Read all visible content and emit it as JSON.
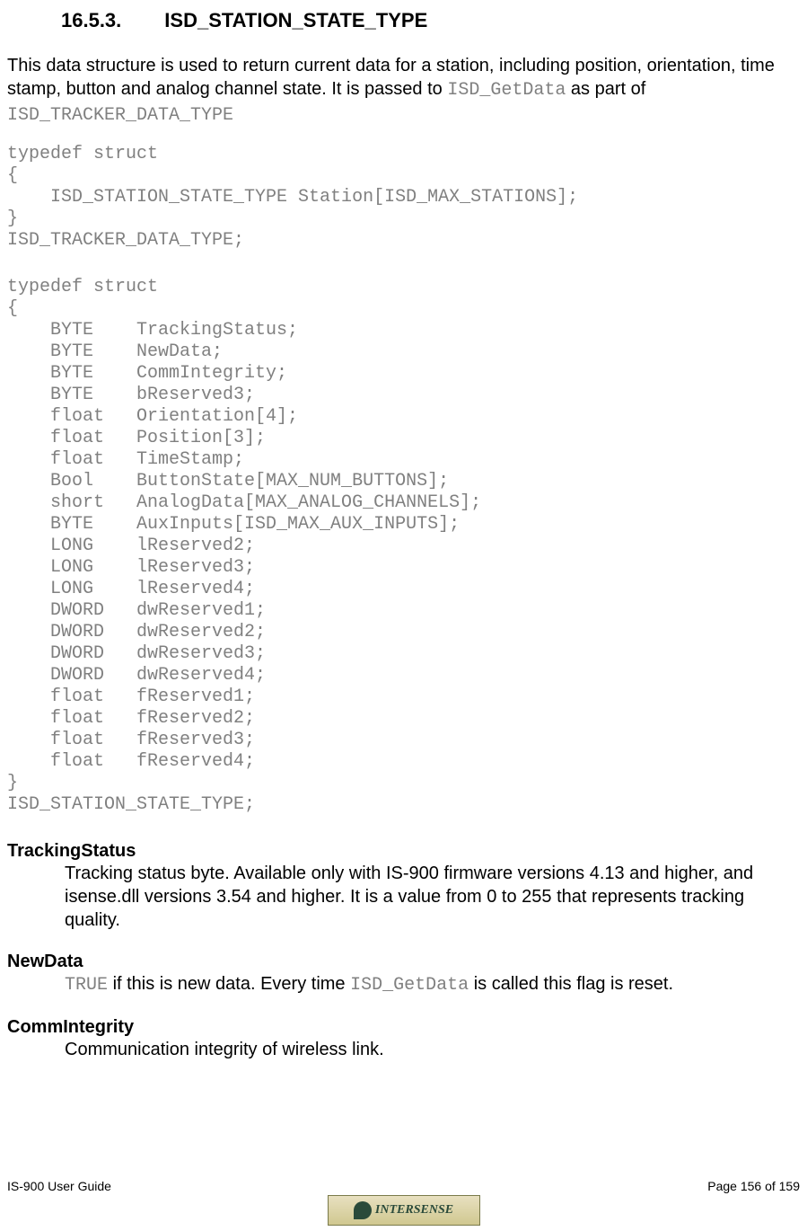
{
  "heading": {
    "number": "16.5.3.",
    "title": "ISD_STATION_STATE_TYPE"
  },
  "intro": {
    "text_before": "This data structure is used to return current data for a station, including position, orientation, time stamp, button and analog channel state.  It is passed to ",
    "code1": "ISD_GetData",
    "text_mid": " as part of ",
    "code2": "ISD_TRACKER_DATA_TYPE"
  },
  "code_block_1": "typedef struct\n{\n    ISD_STATION_STATE_TYPE Station[ISD_MAX_STATIONS];\n}\nISD_TRACKER_DATA_TYPE;",
  "code_block_2": "typedef struct\n{\n    BYTE    TrackingStatus;\n    BYTE    NewData;\n    BYTE    CommIntegrity;\n    BYTE    bReserved3;\n    float   Orientation[4];\n    float   Position[3];\n    float   TimeStamp;\n    Bool    ButtonState[MAX_NUM_BUTTONS];\n    short   AnalogData[MAX_ANALOG_CHANNELS];\n    BYTE    AuxInputs[ISD_MAX_AUX_INPUTS];\n    LONG    lReserved2;\n    LONG    lReserved3;\n    LONG    lReserved4;\n    DWORD   dwReserved1;\n    DWORD   dwReserved2;\n    DWORD   dwReserved3;\n    DWORD   dwReserved4;\n    float   fReserved1;\n    float   fReserved2;\n    float   fReserved3;\n    float   fReserved4;\n}\nISD_STATION_STATE_TYPE;",
  "fields": {
    "tracking_status": {
      "name": "TrackingStatus",
      "desc": "Tracking status byte.  Available only with IS-900 firmware versions 4.13 and higher, and isense.dll versions 3.54 and higher.  It is a value from 0 to 255 that represents tracking quality."
    },
    "new_data": {
      "name": "NewData",
      "desc_code1": "TRUE",
      "desc_mid1": " if this is new data.  Every time ",
      "desc_code2": "ISD_GetData",
      "desc_mid2": " is called this flag is reset."
    },
    "comm_integrity": {
      "name": "CommIntegrity",
      "desc": "Communication integrity of wireless link."
    }
  },
  "footer": {
    "left": "IS-900 User Guide",
    "right": "Page 156 of 159",
    "logo_text": "INTERSENSE"
  }
}
